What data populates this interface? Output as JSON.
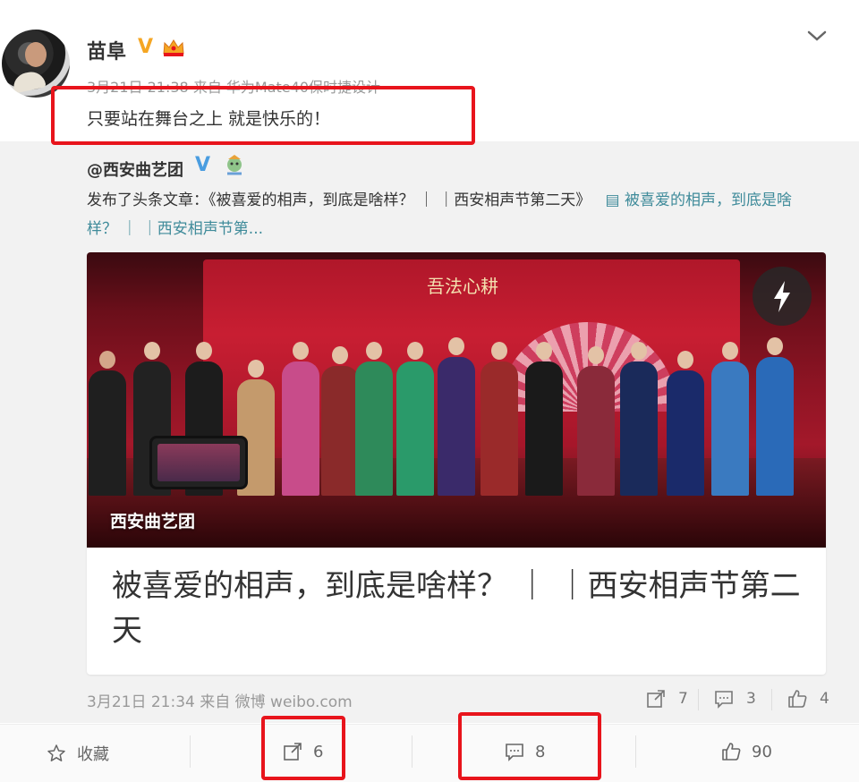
{
  "post": {
    "author": "苗阜",
    "verified_mark": "V",
    "meta": "3月21日 21:38 来自 华为Mate40保时捷设计",
    "text": "只要站在舞台之上 就是快乐的！"
  },
  "repost": {
    "author": "@西安曲艺团",
    "verified_mark": "V",
    "text_prefix": "发布了头条文章：《被喜爱的相声，到底是啥样？ ｜ ｜西安相声节第二天》",
    "link_text": "被喜爱的相声，到底是啥样？ ｜ ｜西安相声节第...",
    "article": {
      "banner_caption": "吾法心耕",
      "watermark": "西安曲艺团",
      "title": "被喜爱的相声，到底是啥样？ ｜ ｜西安相声节第二天"
    },
    "footer_meta": "3月21日 21:34 来自 微博 weibo.com",
    "stats": {
      "reposts": "7",
      "comments": "3",
      "likes": "4"
    }
  },
  "actions": {
    "favorite_label": "收藏",
    "repost_count": "6",
    "comment_count": "8",
    "like_count": "90"
  },
  "colors": {
    "highlight_red": "#e8141c",
    "verified_orange": "#f5a623",
    "verified_blue": "#4a9de0",
    "link_teal": "#3f8b9a"
  },
  "icons": [
    "chevron-down-icon",
    "crown-icon",
    "flash-icon",
    "article-icon",
    "repost-icon",
    "comment-icon",
    "like-icon",
    "star-icon"
  ]
}
